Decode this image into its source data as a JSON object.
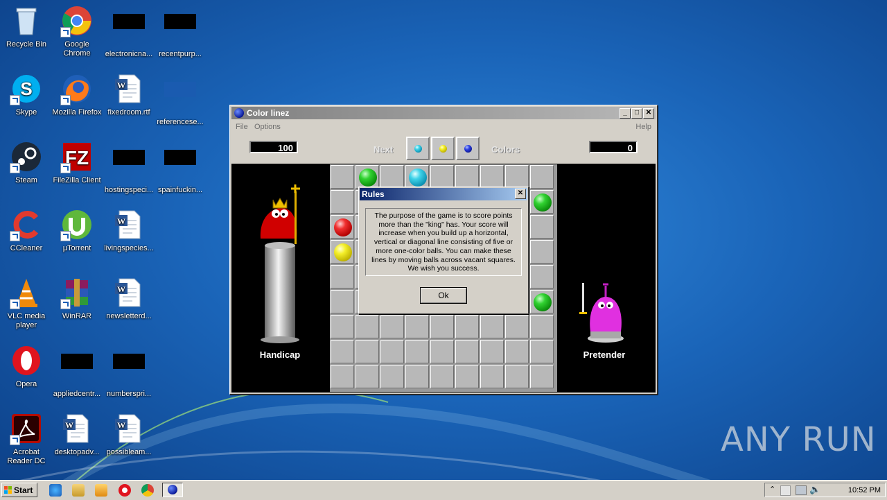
{
  "desktop": {
    "icons": [
      {
        "label": "Recycle Bin"
      },
      {
        "label": "Google Chrome"
      },
      {
        "label": "electronicna..."
      },
      {
        "label": "recentpurp..."
      },
      {
        "label": "Skype"
      },
      {
        "label": "Mozilla Firefox"
      },
      {
        "label": "fixedroom.rtf"
      },
      {
        "label": "referencese..."
      },
      {
        "label": "Steam"
      },
      {
        "label": "FileZilla Client"
      },
      {
        "label": "hostingspeci..."
      },
      {
        "label": "spainfuckin..."
      },
      {
        "label": "CCleaner"
      },
      {
        "label": "µTorrent"
      },
      {
        "label": "livingspecies..."
      },
      {
        "label": "VLC media player"
      },
      {
        "label": "WinRAR"
      },
      {
        "label": "newsletterd..."
      },
      {
        "label": "Opera"
      },
      {
        "label": "appliedcentr..."
      },
      {
        "label": "numberspri..."
      },
      {
        "label": "Acrobat Reader DC"
      },
      {
        "label": "desktopadv..."
      },
      {
        "label": "possibleam..."
      }
    ]
  },
  "window": {
    "title": "Color linez",
    "menu": {
      "file": "File",
      "options": "Options",
      "help": "Help"
    },
    "buttons": {
      "minimize": "_",
      "maximize": "□",
      "close": "✕"
    },
    "toolbar": {
      "left_score": "100",
      "next_label": "Next",
      "next_balls": [
        "cyan",
        "yellow",
        "blue"
      ],
      "colors_label": "Colors",
      "right_score": "0"
    },
    "players": {
      "left": "Handicap",
      "right": "Pretender"
    },
    "board_balls": [
      {
        "row": 0,
        "col": 1,
        "color": "green"
      },
      {
        "row": 0,
        "col": 3,
        "color": "cyan"
      },
      {
        "row": 1,
        "col": 8,
        "color": "green"
      },
      {
        "row": 2,
        "col": 0,
        "color": "red"
      },
      {
        "row": 3,
        "col": 0,
        "color": "yellow"
      },
      {
        "row": 5,
        "col": 8,
        "color": "green"
      }
    ],
    "colors": {
      "green": "#31d231",
      "cyan": "#3fd3e9",
      "red": "#f03030",
      "yellow": "#f4ef2a",
      "blue": "#2b3ee0"
    }
  },
  "dialog": {
    "title": "Rules",
    "close": "✕",
    "text": "The purpose of the game is to score points more than the \"king\" has. Your score will increase when you build up a horizontal, vertical or diagonal line consisting of five or more one-color balls. You can make these lines by moving balls across vacant squares. We wish you success.",
    "ok_label": "Ok"
  },
  "taskbar": {
    "start_label": "Start",
    "clock": "10:52 PM"
  },
  "watermark": "ANY RUN"
}
